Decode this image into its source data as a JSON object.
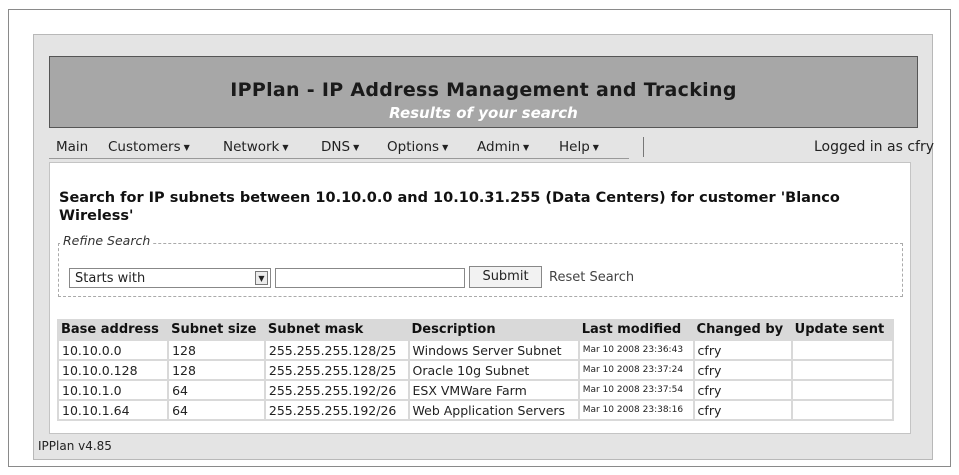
{
  "banner": {
    "title": "IPPlan - IP Address Management and Tracking",
    "subtitle": "Results of your search"
  },
  "menu": {
    "items": [
      {
        "label": "Main",
        "dropdown": false
      },
      {
        "label": "Customers",
        "dropdown": true
      },
      {
        "label": "Network",
        "dropdown": true
      },
      {
        "label": "DNS",
        "dropdown": true
      },
      {
        "label": "Options",
        "dropdown": true
      },
      {
        "label": "Admin",
        "dropdown": true
      },
      {
        "label": "Help",
        "dropdown": true
      }
    ],
    "logged_in": "Logged in as cfry"
  },
  "search": {
    "heading": "Search for IP subnets between 10.10.0.0 and 10.10.31.255 (Data Centers) for customer 'Blanco Wireless'",
    "refine_legend": "Refine Search",
    "select_value": "Starts with",
    "input_value": "",
    "submit_label": "Submit",
    "reset_label": "Reset Search"
  },
  "table": {
    "headers": [
      "Base address",
      "Subnet size",
      "Subnet mask",
      "Description",
      "Last modified",
      "Changed by",
      "Update sent"
    ],
    "rows": [
      [
        "10.10.0.0",
        "128",
        "255.255.255.128/25",
        "Windows Server Subnet",
        "Mar 10 2008 23:36:43",
        "cfry",
        ""
      ],
      [
        "10.10.0.128",
        "128",
        "255.255.255.128/25",
        "Oracle 10g Subnet",
        "Mar 10 2008 23:37:24",
        "cfry",
        ""
      ],
      [
        "10.10.1.0",
        "64",
        "255.255.255.192/26",
        "ESX VMWare Farm",
        "Mar 10 2008 23:37:54",
        "cfry",
        ""
      ],
      [
        "10.10.1.64",
        "64",
        "255.255.255.192/26",
        "Web Application Servers",
        "Mar 10 2008 23:38:16",
        "cfry",
        ""
      ]
    ]
  },
  "footer": {
    "version": "IPPlan v4.85"
  },
  "icons": {
    "dropdown_caret": "caret-down-icon",
    "select_arrow": "select-arrow-icon"
  }
}
